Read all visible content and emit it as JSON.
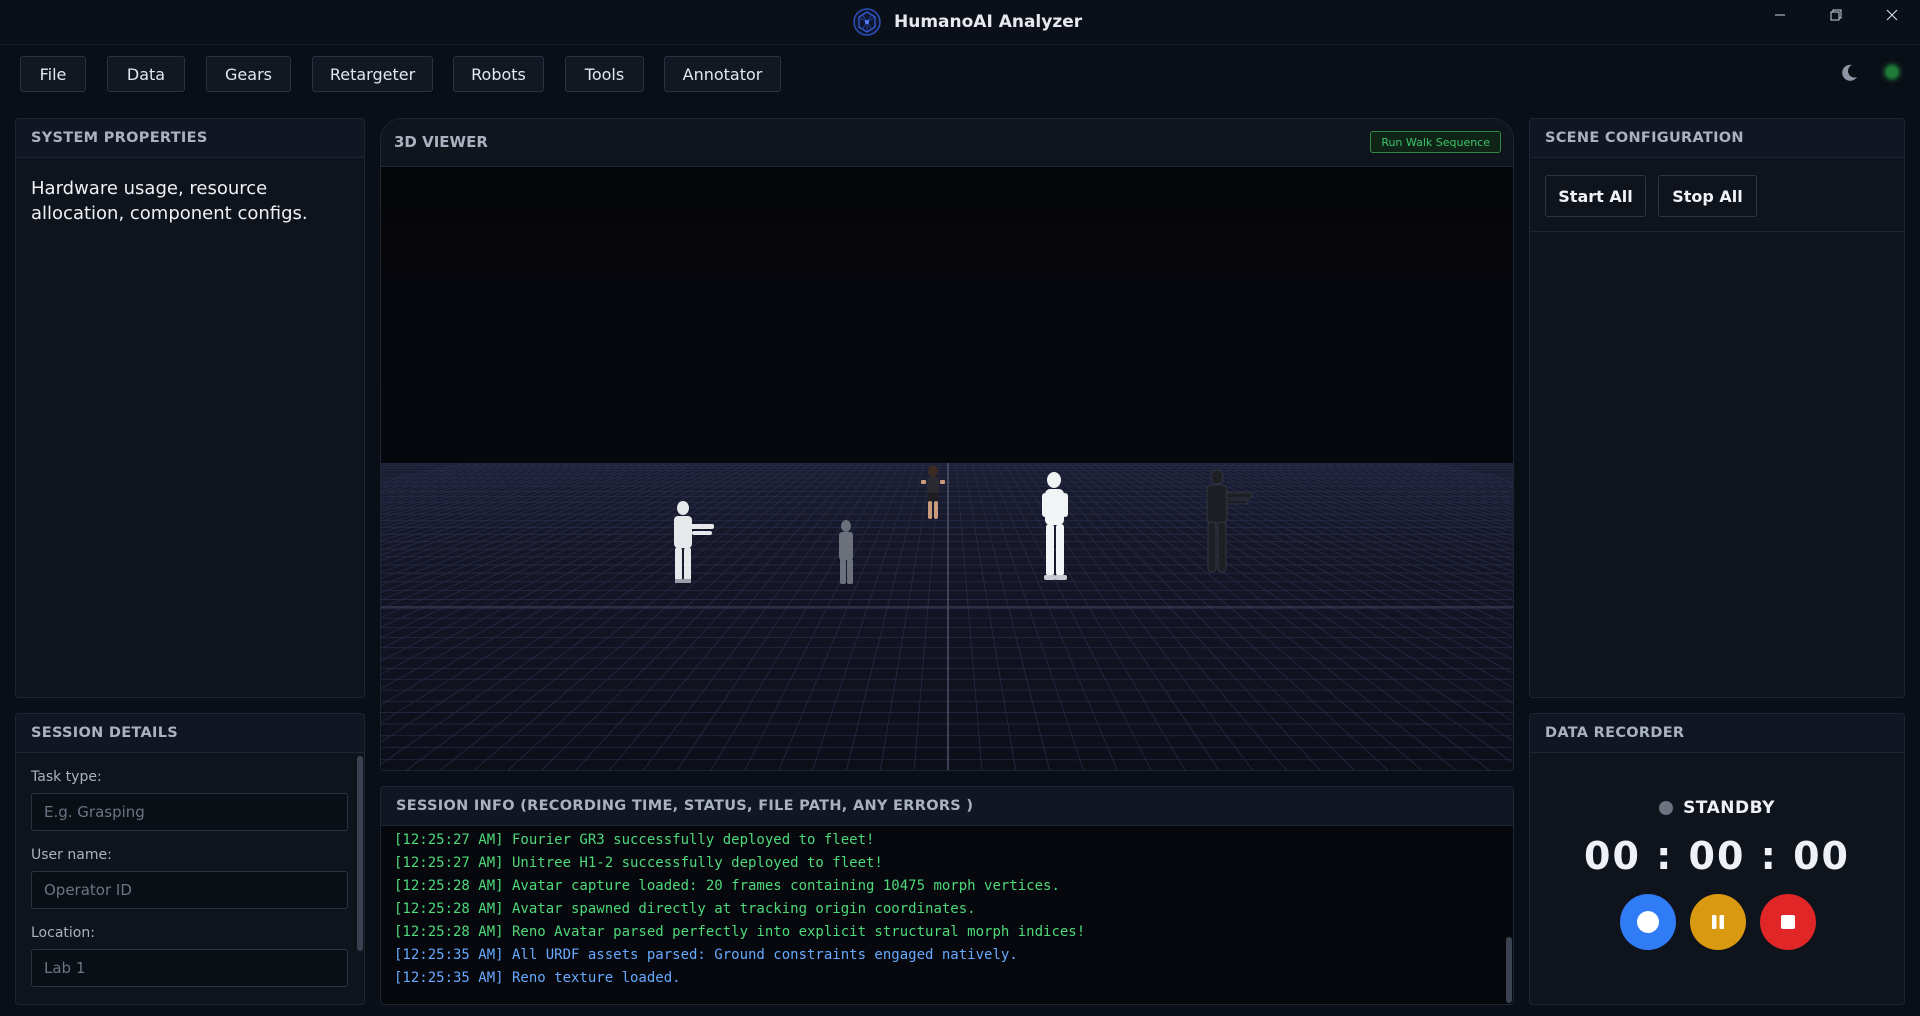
{
  "window": {
    "title": "HumanoAI Analyzer",
    "controls": [
      "minimize-icon",
      "restore-icon",
      "close-icon"
    ]
  },
  "menu": {
    "items": [
      "File",
      "Data",
      "Gears",
      "Retargeter",
      "Robots",
      "Tools",
      "Annotator"
    ]
  },
  "system_properties": {
    "header": "SYSTEM PROPERTIES",
    "description": "Hardware usage, resource allocation, component configs."
  },
  "session_details": {
    "header": "SESSION DETAILS",
    "fields": [
      {
        "label": "Task type:",
        "placeholder": "E.g. Grasping",
        "value": ""
      },
      {
        "label": "User name:",
        "placeholder": "Operator ID",
        "value": ""
      },
      {
        "label": "Location:",
        "placeholder": "Lab 1",
        "value": ""
      }
    ]
  },
  "viewer": {
    "header": "3D VIEWER",
    "run_button": "Run Walk Sequence"
  },
  "scene_config": {
    "header": "SCENE CONFIGURATION",
    "start_all": "Start All",
    "stop_all": "Stop All"
  },
  "session_info": {
    "header": "SESSION INFO (RECORDING TIME, STATUS, FILE PATH, ANY ERRORS )",
    "logs": [
      {
        "text": "[12:25:27 AM] Fourier GR3 successfully deployed to fleet!",
        "color": "green"
      },
      {
        "text": "[12:25:27 AM] Unitree H1-2 successfully deployed to fleet!",
        "color": "green"
      },
      {
        "text": "[12:25:28 AM] Avatar capture loaded: 20 frames containing 10475 morph vertices.",
        "color": "green"
      },
      {
        "text": "[12:25:28 AM] Avatar spawned directly at tracking origin coordinates.",
        "color": "green"
      },
      {
        "text": "[12:25:28 AM] Reno Avatar parsed perfectly into explicit structural morph indices!",
        "color": "green"
      },
      {
        "text": "[12:25:35 AM] All URDF assets parsed: Ground constraints engaged natively.",
        "color": "blue"
      },
      {
        "text": "[12:25:35 AM] Reno texture loaded.",
        "color": "blue"
      }
    ]
  },
  "data_recorder": {
    "header": "DATA RECORDER",
    "status": "STANDBY",
    "timer": "00 : 00 : 00",
    "record_color": "#2f7cf6",
    "pause_color": "#d99a12",
    "stop_color": "#e02626"
  },
  "colors": {
    "background": "#0a0e16",
    "panel": "#0e131c",
    "accent_green": "#3fc46a",
    "log_green": "#4fd97a",
    "log_blue": "#67a9ff"
  }
}
